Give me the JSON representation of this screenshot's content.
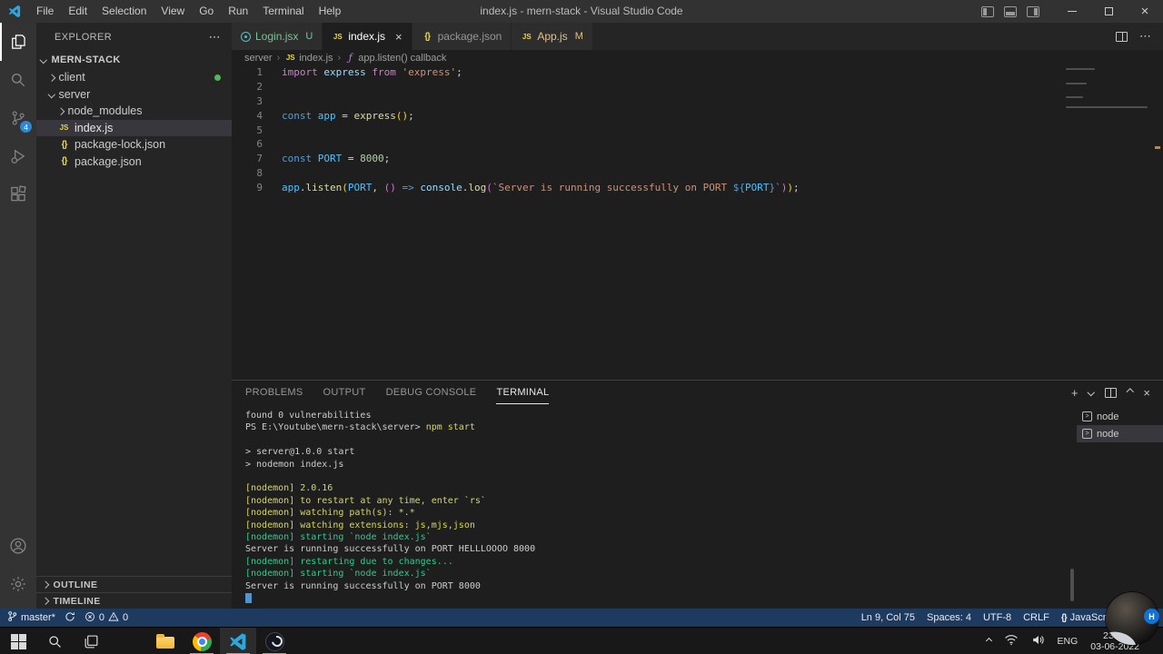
{
  "titlebar": {
    "menus": [
      "File",
      "Edit",
      "Selection",
      "View",
      "Go",
      "Run",
      "Terminal",
      "Help"
    ],
    "title": "index.js - mern-stack - Visual Studio Code"
  },
  "glyphs": {
    "close": "×",
    "more": "⋯",
    "plus": "+",
    "separator": "›"
  },
  "file_icon_glyphs": {
    "js": "JS",
    "json": "{}",
    "symbol": "ƒ"
  },
  "activity_bar": {
    "scm_badge": "4"
  },
  "sidebar": {
    "header": "EXPLORER",
    "project": "MERN-STACK",
    "tree": [
      {
        "label": "client",
        "kind": "folder",
        "expanded": false,
        "level": 1,
        "dot": true
      },
      {
        "label": "server",
        "kind": "folder",
        "expanded": true,
        "level": 1
      },
      {
        "label": "node_modules",
        "kind": "folder",
        "expanded": false,
        "level": 2
      },
      {
        "label": "index.js",
        "kind": "js",
        "level": 2,
        "selected": true
      },
      {
        "label": "package-lock.json",
        "kind": "json",
        "level": 2
      },
      {
        "label": "package.json",
        "kind": "json",
        "level": 2
      }
    ],
    "sections": [
      "OUTLINE",
      "TIMELINE"
    ]
  },
  "editor": {
    "tabs": [
      {
        "label": "Login.jsx",
        "icon": "react",
        "git": "U",
        "state": "untracked"
      },
      {
        "label": "index.js",
        "icon": "js",
        "active": true,
        "closable": true
      },
      {
        "label": "package.json",
        "icon": "json"
      },
      {
        "label": "App.js",
        "icon": "js",
        "git": "M",
        "state": "modified"
      }
    ],
    "breadcrumbs": [
      {
        "label": "server"
      },
      {
        "label": "index.js",
        "icon": "js"
      },
      {
        "label": "app.listen() callback",
        "icon": "symbol-function"
      }
    ],
    "lines": [
      {
        "n": "1",
        "segs": [
          [
            "kw2",
            "import"
          ],
          [
            "fg",
            " "
          ],
          [
            "var",
            "express"
          ],
          [
            "fg",
            " "
          ],
          [
            "kw2",
            "from"
          ],
          [
            "fg",
            " "
          ],
          [
            "str",
            "'express'"
          ],
          [
            "fg",
            ";"
          ]
        ]
      },
      {
        "n": "2",
        "segs": []
      },
      {
        "n": "3",
        "segs": []
      },
      {
        "n": "4",
        "segs": [
          [
            "kw",
            "const"
          ],
          [
            "fg",
            " "
          ],
          [
            "cvar",
            "app"
          ],
          [
            "fg",
            " = "
          ],
          [
            "fn",
            "express"
          ],
          [
            "b1",
            "()"
          ],
          [
            "fg",
            ";"
          ]
        ]
      },
      {
        "n": "5",
        "segs": []
      },
      {
        "n": "6",
        "segs": []
      },
      {
        "n": "7",
        "segs": [
          [
            "kw",
            "const"
          ],
          [
            "fg",
            " "
          ],
          [
            "cvar",
            "PORT"
          ],
          [
            "fg",
            " = "
          ],
          [
            "num",
            "8000"
          ],
          [
            "fg",
            ";"
          ]
        ]
      },
      {
        "n": "8",
        "segs": []
      },
      {
        "n": "9",
        "segs": [
          [
            "cvar",
            "app"
          ],
          [
            "fg",
            "."
          ],
          [
            "fn",
            "listen"
          ],
          [
            "b1",
            "("
          ],
          [
            "cvar",
            "PORT"
          ],
          [
            "fg",
            ", "
          ],
          [
            "b2",
            "()"
          ],
          [
            "fg",
            " "
          ],
          [
            "kw",
            "=>"
          ],
          [
            "fg",
            " "
          ],
          [
            "var",
            "console"
          ],
          [
            "fg",
            "."
          ],
          [
            "fn",
            "log"
          ],
          [
            "b2",
            "("
          ],
          [
            "str",
            "`Server is running successfully on PORT "
          ],
          [
            "kw",
            "${"
          ],
          [
            "cvar",
            "PORT"
          ],
          [
            "kw",
            "}"
          ],
          [
            "str",
            "`"
          ],
          [
            "b2",
            ")"
          ],
          [
            "b1",
            ")"
          ],
          [
            "fg",
            ";"
          ]
        ]
      }
    ]
  },
  "panel": {
    "tabs": [
      "PROBLEMS",
      "OUTPUT",
      "DEBUG CONSOLE",
      "TERMINAL"
    ],
    "active_tab": "TERMINAL",
    "terminal_lines": [
      {
        "parts": [
          {
            "t": "found 0 vulnerabilities",
            "c": "d"
          }
        ]
      },
      {
        "parts": [
          {
            "t": "PS E:\\Youtube\\mern-stack\\server> ",
            "c": "d"
          },
          {
            "t": "npm start",
            "c": "y"
          }
        ]
      },
      {
        "parts": []
      },
      {
        "parts": [
          {
            "t": "> server@1.0.0 start",
            "c": "d"
          }
        ]
      },
      {
        "parts": [
          {
            "t": "> nodemon index.js",
            "c": "d"
          }
        ]
      },
      {
        "parts": []
      },
      {
        "parts": [
          {
            "t": "[nodemon] 2.0.16",
            "c": "y"
          }
        ]
      },
      {
        "parts": [
          {
            "t": "[nodemon] to restart at any time, enter `rs`",
            "c": "y"
          }
        ]
      },
      {
        "parts": [
          {
            "t": "[nodemon] watching path(s): *.*",
            "c": "y"
          }
        ]
      },
      {
        "parts": [
          {
            "t": "[nodemon] watching extensions: js,mjs,json",
            "c": "y"
          }
        ]
      },
      {
        "parts": [
          {
            "t": "[nodemon] starting `node index.js`",
            "c": "g"
          }
        ]
      },
      {
        "parts": [
          {
            "t": "Server is running successfully on PORT HELLLOOOO 8000",
            "c": "d"
          }
        ]
      },
      {
        "parts": [
          {
            "t": "[nodemon] restarting due to changes...",
            "c": "g"
          }
        ]
      },
      {
        "parts": [
          {
            "t": "[nodemon] starting `node index.js`",
            "c": "g"
          }
        ]
      },
      {
        "parts": [
          {
            "t": "Server is running successfully on PORT 8000",
            "c": "d"
          }
        ]
      },
      {
        "parts": [],
        "cursor": true
      }
    ],
    "terminal_sessions": [
      {
        "label": "node"
      },
      {
        "label": "node",
        "selected": true
      }
    ]
  },
  "status_bar": {
    "branch": "master*",
    "errors": "0",
    "warnings": "0",
    "cursor_position": "Ln 9, Col 75",
    "indentation": "Spaces: 4",
    "encoding": "UTF-8",
    "eol": "CRLF",
    "language_icon": "{}",
    "language": "JavaScript"
  },
  "taskbar": {
    "lang": "ENG",
    "time": "23:16",
    "date": "03-06-2022"
  },
  "webcam": {
    "badge": "H"
  }
}
